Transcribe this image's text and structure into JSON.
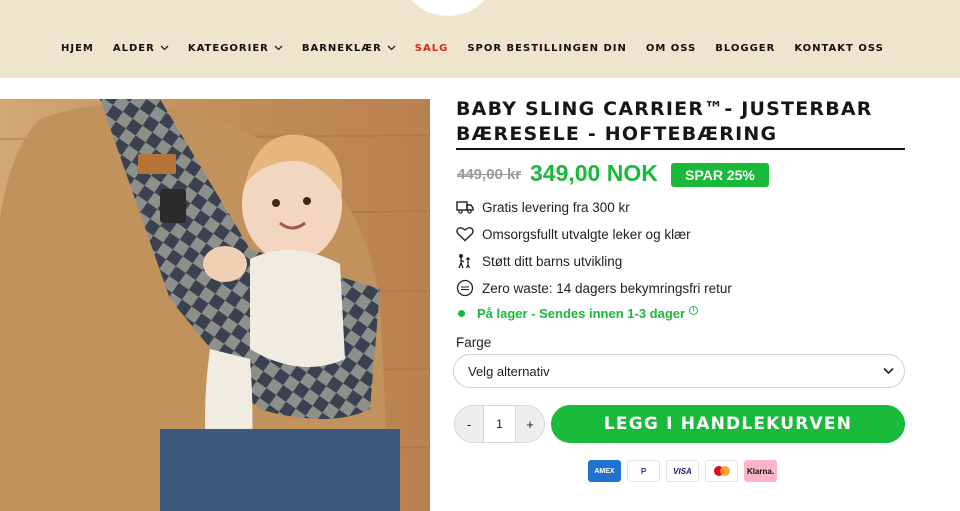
{
  "nav": {
    "items": [
      {
        "label": "HJEM",
        "dropdown": false,
        "highlight": false
      },
      {
        "label": "ALDER",
        "dropdown": true,
        "highlight": false
      },
      {
        "label": "KATEGORIER",
        "dropdown": true,
        "highlight": false
      },
      {
        "label": "BARNEKLÆR",
        "dropdown": true,
        "highlight": false
      },
      {
        "label": "SALG",
        "dropdown": false,
        "highlight": true
      },
      {
        "label": "SPOR BESTILLINGEN DIN",
        "dropdown": false,
        "highlight": false
      },
      {
        "label": "OM OSS",
        "dropdown": false,
        "highlight": false
      },
      {
        "label": "BLOGGER",
        "dropdown": false,
        "highlight": false
      },
      {
        "label": "KONTAKT OSS",
        "dropdown": false,
        "highlight": false
      }
    ]
  },
  "product": {
    "title_line1": "BABY SLING CARRIER™- JUSTERBAR",
    "title_line2": "BÆRESELE - HOFTEBÆRING",
    "old_price": "449,00 kr",
    "price": "349,00 NOK",
    "save_badge": "SPAR 25%",
    "features": [
      {
        "icon": "truck-icon",
        "text": "Gratis levering fra 300 kr"
      },
      {
        "icon": "heart-icon",
        "text": "Omsorgsfullt utvalgte leker og klær"
      },
      {
        "icon": "family-icon",
        "text": "Støtt ditt barns utvikling"
      },
      {
        "icon": "zero-waste-icon",
        "text": "Zero waste: 14 dagers bekymringsfri retur"
      }
    ],
    "stock_text": "På lager - Sendes innen 1-3 dager",
    "color_label": "Farge",
    "color_select_value": "Velg alternativ",
    "quantity": "1",
    "qty_minus": "-",
    "qty_plus": "+",
    "add_to_cart": "LEGG I HANDLEKURVEN"
  },
  "payments": [
    "AMEX",
    "P",
    "VISA",
    "",
    "Klarna."
  ],
  "colors": {
    "header_bg": "#efe4cc",
    "accent_green": "#19b93a",
    "sale_red": "#e0241b"
  }
}
